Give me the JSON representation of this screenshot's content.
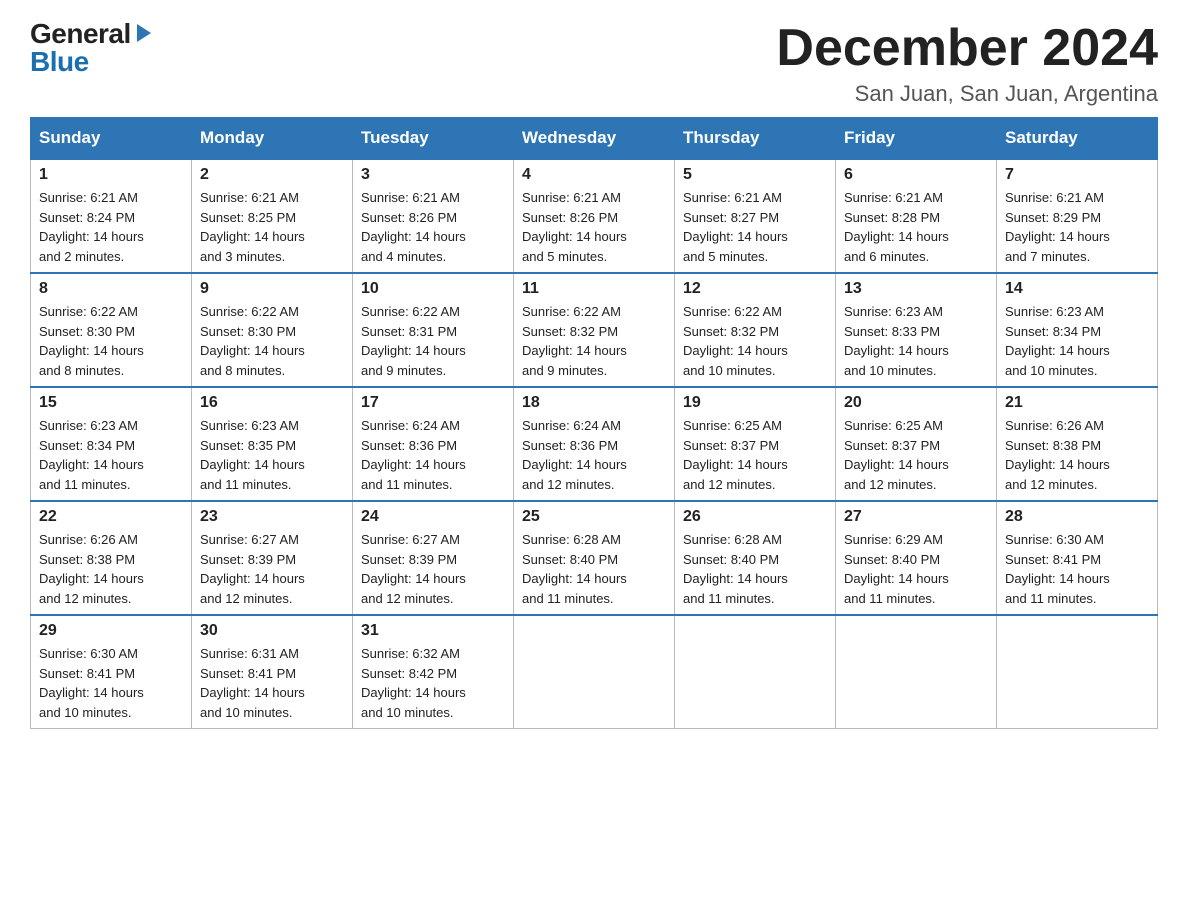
{
  "logo": {
    "general": "General",
    "blue": "Blue"
  },
  "title": "December 2024",
  "location": "San Juan, San Juan, Argentina",
  "days_of_week": [
    "Sunday",
    "Monday",
    "Tuesday",
    "Wednesday",
    "Thursday",
    "Friday",
    "Saturday"
  ],
  "weeks": [
    [
      {
        "day": "1",
        "sunrise": "6:21 AM",
        "sunset": "8:24 PM",
        "daylight": "14 hours and 2 minutes."
      },
      {
        "day": "2",
        "sunrise": "6:21 AM",
        "sunset": "8:25 PM",
        "daylight": "14 hours and 3 minutes."
      },
      {
        "day": "3",
        "sunrise": "6:21 AM",
        "sunset": "8:26 PM",
        "daylight": "14 hours and 4 minutes."
      },
      {
        "day": "4",
        "sunrise": "6:21 AM",
        "sunset": "8:26 PM",
        "daylight": "14 hours and 5 minutes."
      },
      {
        "day": "5",
        "sunrise": "6:21 AM",
        "sunset": "8:27 PM",
        "daylight": "14 hours and 5 minutes."
      },
      {
        "day": "6",
        "sunrise": "6:21 AM",
        "sunset": "8:28 PM",
        "daylight": "14 hours and 6 minutes."
      },
      {
        "day": "7",
        "sunrise": "6:21 AM",
        "sunset": "8:29 PM",
        "daylight": "14 hours and 7 minutes."
      }
    ],
    [
      {
        "day": "8",
        "sunrise": "6:22 AM",
        "sunset": "8:30 PM",
        "daylight": "14 hours and 8 minutes."
      },
      {
        "day": "9",
        "sunrise": "6:22 AM",
        "sunset": "8:30 PM",
        "daylight": "14 hours and 8 minutes."
      },
      {
        "day": "10",
        "sunrise": "6:22 AM",
        "sunset": "8:31 PM",
        "daylight": "14 hours and 9 minutes."
      },
      {
        "day": "11",
        "sunrise": "6:22 AM",
        "sunset": "8:32 PM",
        "daylight": "14 hours and 9 minutes."
      },
      {
        "day": "12",
        "sunrise": "6:22 AM",
        "sunset": "8:32 PM",
        "daylight": "14 hours and 10 minutes."
      },
      {
        "day": "13",
        "sunrise": "6:23 AM",
        "sunset": "8:33 PM",
        "daylight": "14 hours and 10 minutes."
      },
      {
        "day": "14",
        "sunrise": "6:23 AM",
        "sunset": "8:34 PM",
        "daylight": "14 hours and 10 minutes."
      }
    ],
    [
      {
        "day": "15",
        "sunrise": "6:23 AM",
        "sunset": "8:34 PM",
        "daylight": "14 hours and 11 minutes."
      },
      {
        "day": "16",
        "sunrise": "6:23 AM",
        "sunset": "8:35 PM",
        "daylight": "14 hours and 11 minutes."
      },
      {
        "day": "17",
        "sunrise": "6:24 AM",
        "sunset": "8:36 PM",
        "daylight": "14 hours and 11 minutes."
      },
      {
        "day": "18",
        "sunrise": "6:24 AM",
        "sunset": "8:36 PM",
        "daylight": "14 hours and 12 minutes."
      },
      {
        "day": "19",
        "sunrise": "6:25 AM",
        "sunset": "8:37 PM",
        "daylight": "14 hours and 12 minutes."
      },
      {
        "day": "20",
        "sunrise": "6:25 AM",
        "sunset": "8:37 PM",
        "daylight": "14 hours and 12 minutes."
      },
      {
        "day": "21",
        "sunrise": "6:26 AM",
        "sunset": "8:38 PM",
        "daylight": "14 hours and 12 minutes."
      }
    ],
    [
      {
        "day": "22",
        "sunrise": "6:26 AM",
        "sunset": "8:38 PM",
        "daylight": "14 hours and 12 minutes."
      },
      {
        "day": "23",
        "sunrise": "6:27 AM",
        "sunset": "8:39 PM",
        "daylight": "14 hours and 12 minutes."
      },
      {
        "day": "24",
        "sunrise": "6:27 AM",
        "sunset": "8:39 PM",
        "daylight": "14 hours and 12 minutes."
      },
      {
        "day": "25",
        "sunrise": "6:28 AM",
        "sunset": "8:40 PM",
        "daylight": "14 hours and 11 minutes."
      },
      {
        "day": "26",
        "sunrise": "6:28 AM",
        "sunset": "8:40 PM",
        "daylight": "14 hours and 11 minutes."
      },
      {
        "day": "27",
        "sunrise": "6:29 AM",
        "sunset": "8:40 PM",
        "daylight": "14 hours and 11 minutes."
      },
      {
        "day": "28",
        "sunrise": "6:30 AM",
        "sunset": "8:41 PM",
        "daylight": "14 hours and 11 minutes."
      }
    ],
    [
      {
        "day": "29",
        "sunrise": "6:30 AM",
        "sunset": "8:41 PM",
        "daylight": "14 hours and 10 minutes."
      },
      {
        "day": "30",
        "sunrise": "6:31 AM",
        "sunset": "8:41 PM",
        "daylight": "14 hours and 10 minutes."
      },
      {
        "day": "31",
        "sunrise": "6:32 AM",
        "sunset": "8:42 PM",
        "daylight": "14 hours and 10 minutes."
      },
      null,
      null,
      null,
      null
    ]
  ],
  "labels": {
    "sunrise": "Sunrise:",
    "sunset": "Sunset:",
    "daylight": "Daylight:"
  }
}
